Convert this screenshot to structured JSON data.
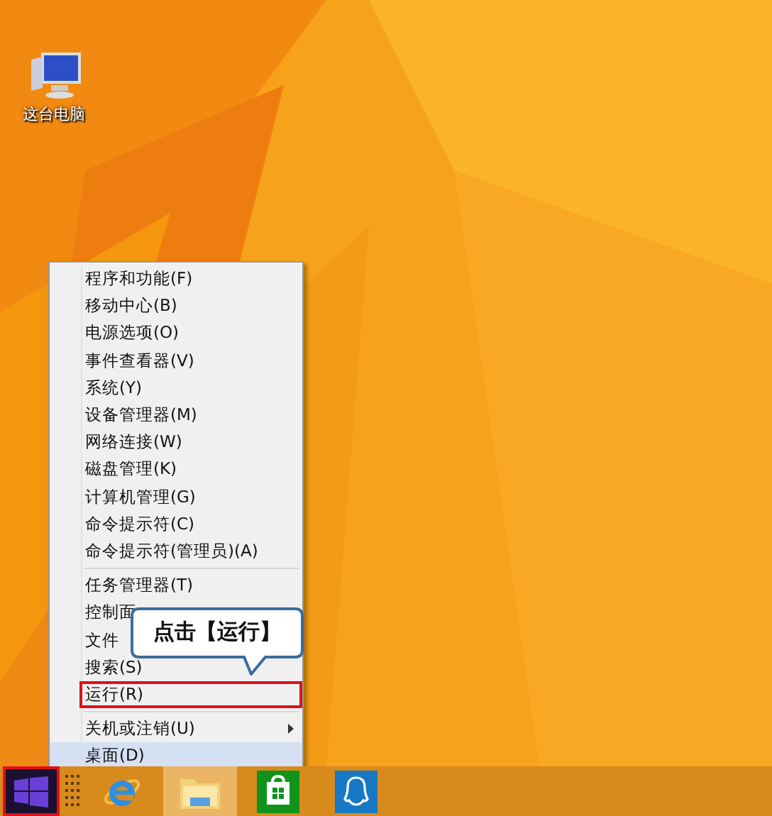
{
  "desktop_icons": [
    {
      "label": "这台电脑"
    }
  ],
  "context_menu": {
    "items": [
      {
        "kind": "item",
        "label": "程序和功能(F)",
        "selected": false,
        "submenu": false,
        "highlighted": false
      },
      {
        "kind": "item",
        "label": "移动中心(B)",
        "selected": false,
        "submenu": false,
        "highlighted": false
      },
      {
        "kind": "item",
        "label": "电源选项(O)",
        "selected": false,
        "submenu": false,
        "highlighted": false
      },
      {
        "kind": "item",
        "label": "事件查看器(V)",
        "selected": false,
        "submenu": false,
        "highlighted": false
      },
      {
        "kind": "item",
        "label": "系统(Y)",
        "selected": false,
        "submenu": false,
        "highlighted": false
      },
      {
        "kind": "item",
        "label": "设备管理器(M)",
        "selected": false,
        "submenu": false,
        "highlighted": false
      },
      {
        "kind": "item",
        "label": "网络连接(W)",
        "selected": false,
        "submenu": false,
        "highlighted": false
      },
      {
        "kind": "item",
        "label": "磁盘管理(K)",
        "selected": false,
        "submenu": false,
        "highlighted": false
      },
      {
        "kind": "item",
        "label": "计算机管理(G)",
        "selected": false,
        "submenu": false,
        "highlighted": false
      },
      {
        "kind": "item",
        "label": "命令提示符(C)",
        "selected": false,
        "submenu": false,
        "highlighted": false
      },
      {
        "kind": "item",
        "label": "命令提示符(管理员)(A)",
        "selected": false,
        "submenu": false,
        "highlighted": false
      },
      {
        "kind": "separator"
      },
      {
        "kind": "item",
        "label": "任务管理器(T)",
        "selected": false,
        "submenu": false,
        "highlighted": false
      },
      {
        "kind": "item",
        "label": "控制面",
        "selected": false,
        "submenu": false,
        "highlighted": false
      },
      {
        "kind": "item",
        "label": "文件",
        "selected": false,
        "submenu": false,
        "highlighted": false
      },
      {
        "kind": "item",
        "label": "搜索(S)",
        "selected": false,
        "submenu": false,
        "highlighted": false
      },
      {
        "kind": "item",
        "label": "运行(R)",
        "selected": false,
        "submenu": false,
        "highlighted": true
      },
      {
        "kind": "separator"
      },
      {
        "kind": "item",
        "label": "关机或注销(U)",
        "selected": false,
        "submenu": true,
        "highlighted": false
      },
      {
        "kind": "item",
        "label": "桌面(D)",
        "selected": true,
        "submenu": false,
        "highlighted": false
      }
    ]
  },
  "callout": {
    "text": "点击【运行】"
  },
  "taskbar": {
    "start_highlighted": true,
    "apps": [
      {
        "kind": "browser",
        "selected": false
      },
      {
        "kind": "folder",
        "selected": true
      },
      {
        "kind": "store",
        "selected": false
      },
      {
        "kind": "penguin",
        "selected": false
      }
    ]
  }
}
